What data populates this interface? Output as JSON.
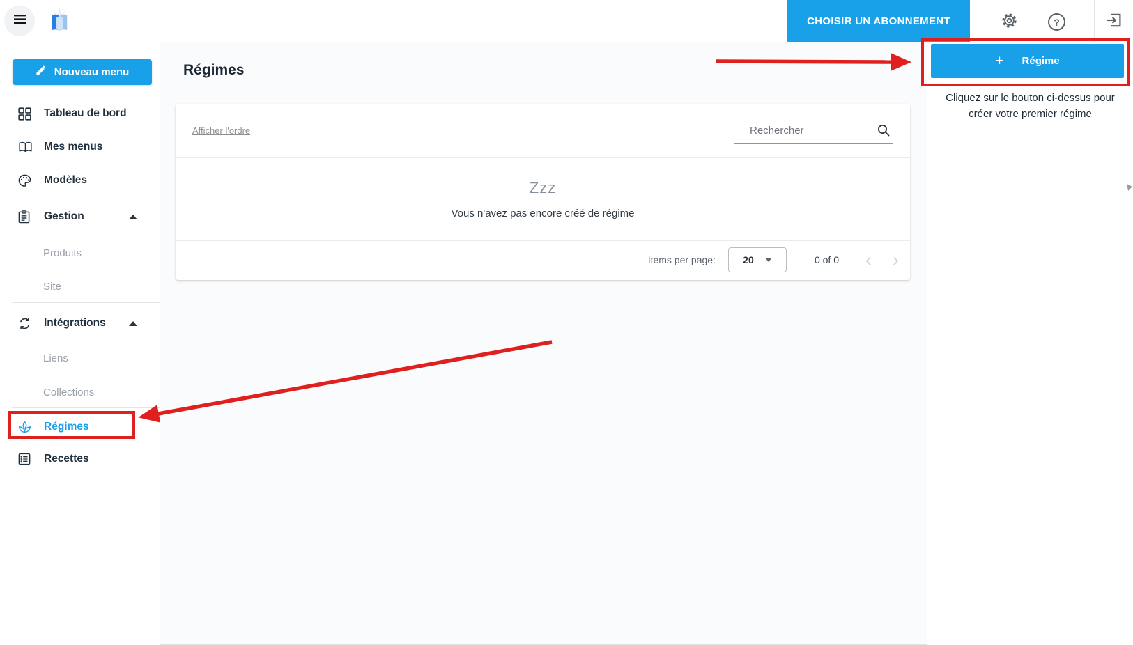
{
  "header": {
    "subscribe_button_label": "CHOISIR UN ABONNEMENT"
  },
  "sidebar": {
    "new_menu_button_label": "Nouveau menu",
    "items": [
      {
        "label": "Tableau de bord"
      },
      {
        "label": "Mes menus"
      },
      {
        "label": "Modèles"
      },
      {
        "label": "Gestion"
      },
      {
        "label": "Produits"
      },
      {
        "label": "Site"
      },
      {
        "label": "Intégrations"
      },
      {
        "label": "Liens"
      },
      {
        "label": "Collections"
      },
      {
        "label": "Régimes"
      },
      {
        "label": "Recettes"
      }
    ]
  },
  "main": {
    "title": "Régimes",
    "order_link_label": "Afficher l'ordre",
    "search": {
      "placeholder": "Rechercher"
    },
    "empty_state": {
      "sleep_text": "Zzz",
      "message": "Vous n'avez pas encore créé de régime"
    },
    "pagination": {
      "items_per_page_label": "Items per page:",
      "page_size": "20",
      "range": "0 of 0"
    }
  },
  "right_panel": {
    "create_button": {
      "plus": "+",
      "label": "Régime"
    },
    "hint_line1": "Cliquez sur le bouton ci-dessus pour",
    "hint_line2": "créer votre premier régime"
  },
  "icons": {
    "help_glyph": "?",
    "chevron_left_glyph": "‹",
    "chevron_right_glyph": "›"
  },
  "colors": {
    "accent": "#18a0e8",
    "annotation_red": "#e01f1f"
  }
}
